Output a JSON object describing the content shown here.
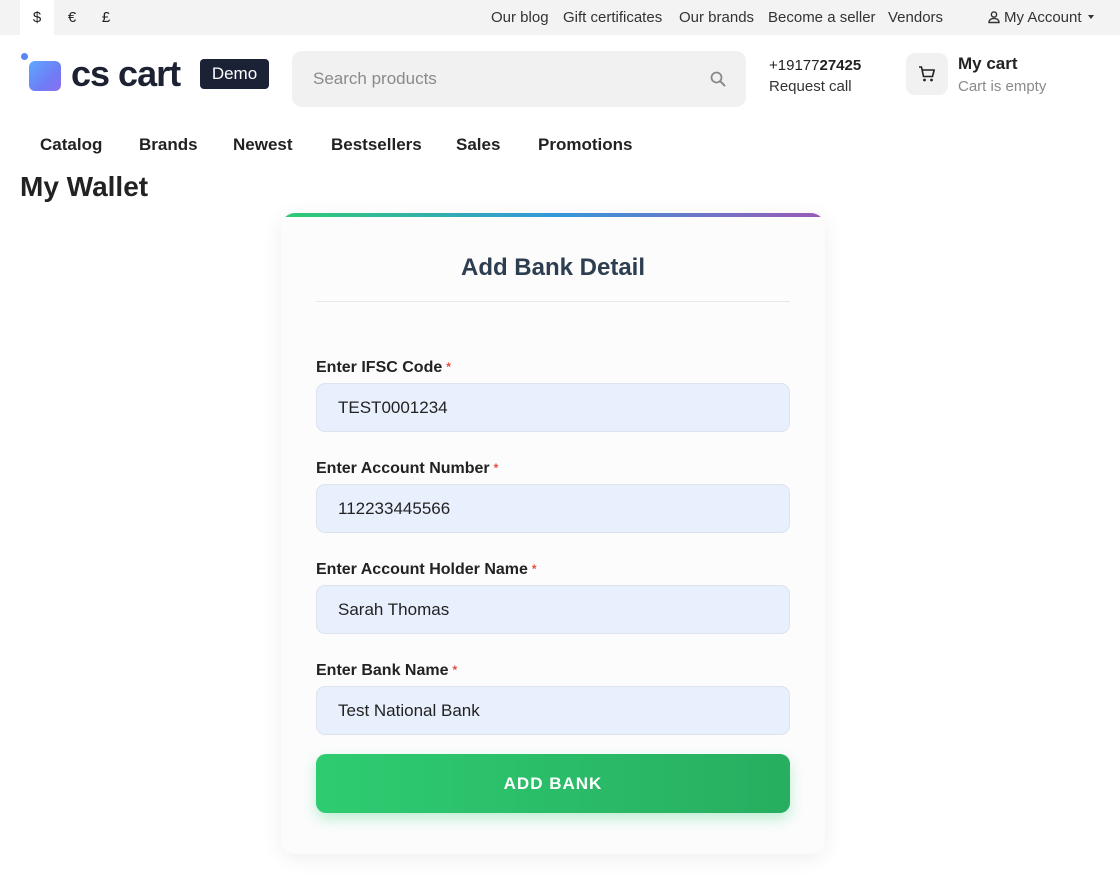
{
  "topbar": {
    "currencies": [
      "$",
      "€",
      "£"
    ],
    "links": [
      "Our blog",
      "Gift certificates",
      "Our brands",
      "Become a seller",
      "Vendors"
    ],
    "account_label": "My Account"
  },
  "header": {
    "logo_text": "cs cart",
    "demo_badge": "Demo",
    "search_placeholder": "Search products",
    "phone_prefix": "+19177",
    "phone_bold": "27425",
    "request_call": "Request call",
    "cart_title": "My cart",
    "cart_status": "Cart is empty"
  },
  "nav": {
    "items": [
      "Catalog",
      "Brands",
      "Newest",
      "Bestsellers",
      "Sales",
      "Promotions"
    ]
  },
  "page": {
    "title": "My Wallet"
  },
  "form": {
    "title": "Add Bank Detail",
    "required_mark": "*",
    "fields": [
      {
        "label": "Enter IFSC Code",
        "value": "TEST0001234"
      },
      {
        "label": "Enter Account Number",
        "value": "112233445566"
      },
      {
        "label": "Enter Account Holder Name",
        "value": "Sarah Thomas"
      },
      {
        "label": "Enter Bank Name",
        "value": "Test National Bank"
      }
    ],
    "submit_label": "ADD BANK"
  },
  "colors": {
    "accent_green": "#2ecc71",
    "title_dark": "#2c3e50",
    "required_red": "#e74c3c",
    "input_bg": "#e8f0fe"
  }
}
